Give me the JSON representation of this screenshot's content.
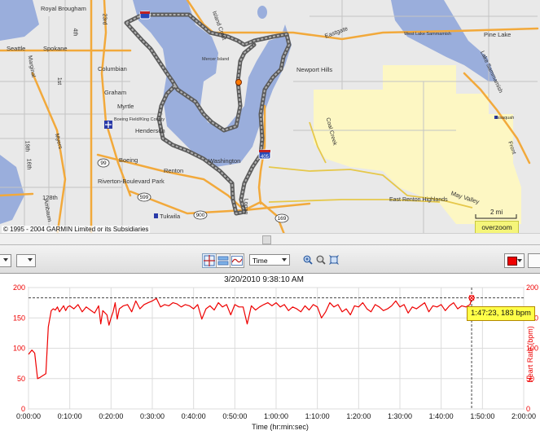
{
  "map": {
    "labels": [
      "Royal Brougham",
      "Seattle",
      "Spokane",
      "Columbian",
      "Graham",
      "Myrtle",
      "Boeing Field/King County",
      "Henderson",
      "Boeing",
      "Riverton-Boulevard Park",
      "Renton",
      "Tukwila",
      "Mercer Island",
      "Newport Hills",
      "East Renton Highlands",
      "May Valley",
      "West Lake Sammamish",
      "Pine Lake",
      "Lake Sammamish",
      "Issaquah",
      "Coal Creek",
      "Eastgate",
      "Washington",
      "Island Crest",
      "Marginal",
      "Ambaum",
      "128th",
      "Myers",
      "16th",
      "19th",
      "1st",
      "4th",
      "23rd",
      "Front",
      "Logan"
    ],
    "route_signs": [
      "90",
      "99",
      "599",
      "900",
      "169",
      "405",
      "5"
    ],
    "copyright": "© 1995 - 2004 GARMIN Limited or its Subsidiaries",
    "scale": "2 mi",
    "overzoom": "overzoom"
  },
  "toolbar": {
    "x_axis_mode": "Time",
    "color_value": "#ee0000"
  },
  "chart_data": {
    "type": "line",
    "title": "3/20/2010 9:38:10 AM",
    "xlabel": "Time (hr:min:sec)",
    "ylabel": "Heart Rate (bpm)",
    "x_ticks": [
      "0:00:00",
      "0:10:00",
      "0:20:00",
      "0:30:00",
      "0:40:00",
      "0:50:00",
      "1:00:00",
      "1:10:00",
      "1:20:00",
      "1:30:00",
      "1:40:00",
      "1:50:00",
      "2:00:00"
    ],
    "y_ticks": [
      "0",
      "50",
      "100",
      "150",
      "200"
    ],
    "xlim": [
      0,
      120
    ],
    "ylim": [
      0,
      200
    ],
    "grid": true,
    "cursor": {
      "x": 107.38,
      "y": 183,
      "label": "1:47:23, 183 bpm"
    },
    "series": [
      {
        "name": "Heart Rate",
        "color": "#ee0000",
        "x": [
          0,
          0.8,
          1.5,
          2.2,
          2.8,
          3.5,
          4.2,
          4.8,
          5.5,
          6.0,
          6.5,
          7.0,
          7.5,
          8.0,
          8.5,
          9.0,
          9.5,
          10.0,
          11.0,
          12.0,
          13.0,
          14.0,
          15.0,
          16.0,
          17.0,
          17.5,
          18.0,
          19.0,
          19.5,
          20.0,
          20.5,
          21.0,
          21.5,
          22.0,
          23.0,
          24.0,
          25.0,
          26.0,
          27.0,
          28.0,
          29.0,
          30.0,
          31.0,
          32.0,
          33.0,
          34.0,
          35.0,
          36.0,
          37.0,
          38.0,
          39.0,
          40.0,
          41.0,
          42.0,
          43.0,
          44.0,
          45.0,
          46.0,
          47.0,
          48.0,
          49.0,
          50.0,
          51.0,
          52.0,
          53.0,
          54.0,
          55.0,
          56.0,
          57.0,
          58.0,
          59.0,
          60.0,
          61.0,
          62.0,
          63.0,
          64.0,
          65.0,
          66.0,
          67.0,
          68.0,
          69.0,
          70.0,
          71.0,
          72.0,
          73.0,
          74.0,
          75.0,
          76.0,
          77.0,
          78.0,
          79.0,
          80.0,
          81.0,
          82.0,
          83.0,
          84.0,
          85.0,
          86.0,
          87.0,
          88.0,
          89.0,
          90.0,
          91.0,
          92.0,
          93.0,
          94.0,
          95.0,
          96.0,
          97.0,
          98.0,
          99.0,
          100.0,
          101.0,
          102.0,
          103.0,
          104.0,
          105.0,
          106.0,
          107.0,
          107.4
        ],
        "values": [
          90,
          97,
          92,
          50,
          52,
          55,
          58,
          135,
          162,
          165,
          163,
          168,
          160,
          165,
          170,
          162,
          168,
          170,
          165,
          172,
          160,
          168,
          163,
          158,
          170,
          140,
          162,
          155,
          138,
          150,
          160,
          175,
          148,
          165,
          170,
          172,
          160,
          178,
          165,
          172,
          175,
          178,
          182,
          168,
          172,
          170,
          175,
          173,
          168,
          172,
          170,
          165,
          172,
          148,
          165,
          170,
          163,
          175,
          168,
          172,
          155,
          172,
          168,
          168,
          140,
          170,
          163,
          168,
          172,
          175,
          170,
          175,
          168,
          172,
          162,
          168,
          165,
          160,
          170,
          163,
          172,
          168,
          150,
          160,
          175,
          168,
          172,
          160,
          165,
          155,
          170,
          168,
          175,
          165,
          160,
          172,
          168,
          162,
          165,
          170,
          178,
          168,
          172,
          158,
          168,
          165,
          170,
          175,
          160,
          170,
          168,
          172,
          162,
          170,
          175,
          165,
          170,
          168,
          172,
          183
        ]
      }
    ]
  }
}
